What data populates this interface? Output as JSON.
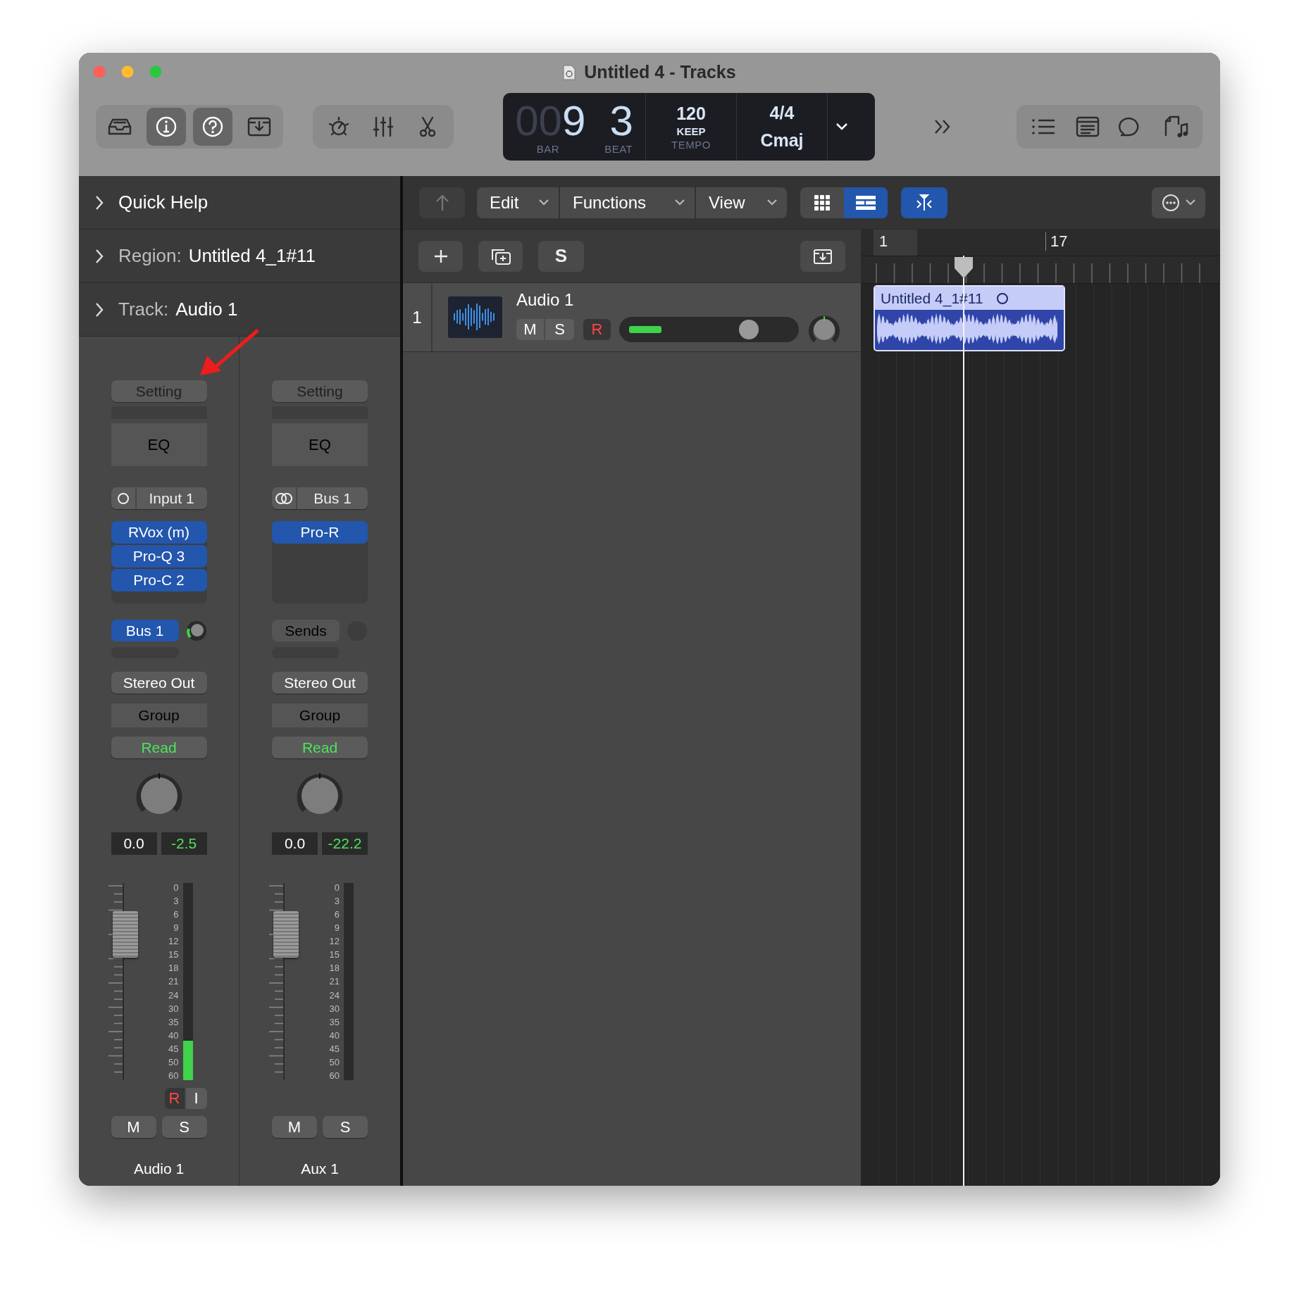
{
  "window": {
    "title": "Untitled 4 - Tracks"
  },
  "toolbar": {
    "left": [
      {
        "kind": "library",
        "selected": false
      },
      {
        "kind": "inspector",
        "selected": true
      },
      {
        "kind": "help",
        "selected": true
      },
      {
        "kind": "download",
        "selected": false
      }
    ],
    "middle": [
      {
        "kind": "gauge"
      },
      {
        "kind": "mixer"
      },
      {
        "kind": "scissors"
      }
    ],
    "lcd": {
      "bar_leading": "00",
      "bar": "9",
      "bar_label": "BAR",
      "beat": "3",
      "beat_label": "BEAT",
      "tempo": "120",
      "tempo_mode": "KEEP",
      "tempo_label": "TEMPO",
      "signature": "4/4",
      "key": "Cmaj"
    },
    "right": [
      {
        "kind": "list"
      },
      {
        "kind": "editor"
      },
      {
        "kind": "loops"
      },
      {
        "kind": "browser"
      }
    ]
  },
  "inspector": {
    "sections": [
      {
        "label": "Quick Help"
      },
      {
        "label": "Region:",
        "value": "Untitled 4_1#11"
      },
      {
        "label": "Track:",
        "value": "Audio 1"
      }
    ],
    "strips": [
      {
        "setting": "Setting",
        "eq": "EQ",
        "input": {
          "kind": "mono",
          "label": "Input 1"
        },
        "plugins": [
          "RVox (m)",
          "Pro-Q 3",
          "Pro-C 2"
        ],
        "send": {
          "kind": "bus",
          "label": "Bus 1"
        },
        "output": "Stereo Out",
        "group": "Group",
        "automation": "Read",
        "volume": "0.0",
        "peak": "-2.5",
        "fader": {
          "level": 0.74
        },
        "meter": {
          "level": 0.2
        },
        "scale": [
          "0",
          "3",
          "6",
          "9",
          "12",
          "15",
          "18",
          "21",
          "24",
          "30",
          "35",
          "40",
          "45",
          "50",
          "60"
        ],
        "record": "R",
        "monitor": "I",
        "mute": "M",
        "solo": "S",
        "name": "Audio 1"
      },
      {
        "setting": "Setting",
        "eq": "EQ",
        "input": {
          "kind": "stereo",
          "label": "Bus 1"
        },
        "plugins": [
          "Pro-R"
        ],
        "send": {
          "kind": "empty",
          "label": "Sends"
        },
        "output": "Stereo Out",
        "group": "Group",
        "automation": "Read",
        "volume": "0.0",
        "peak": "-22.2",
        "fader": {
          "level": 0.74
        },
        "meter": {
          "level": 0
        },
        "scale": [
          "0",
          "3",
          "6",
          "9",
          "12",
          "15",
          "18",
          "21",
          "24",
          "30",
          "35",
          "40",
          "45",
          "50",
          "60"
        ],
        "mute": "M",
        "solo": "S",
        "name": "Aux 1"
      }
    ]
  },
  "tracks_toolbar": {
    "menus": [
      {
        "label": "Edit"
      },
      {
        "label": "Functions"
      },
      {
        "label": "View"
      }
    ],
    "views": [
      {
        "kind": "grid",
        "selected": false
      },
      {
        "kind": "list",
        "selected": true
      }
    ],
    "catch": {
      "selected": true
    }
  },
  "track_header": {
    "buttons": [
      {
        "kind": "add"
      },
      {
        "kind": "duplicate"
      },
      {
        "kind": "solo",
        "label": "S"
      }
    ]
  },
  "tracks": [
    {
      "number": "1",
      "name": "Audio 1",
      "mute": "M",
      "solo": "S",
      "record": "R",
      "selected": true,
      "volume": {
        "level": 0.72
      },
      "meter": {
        "level": 0.2
      }
    }
  ],
  "ruler": {
    "markers": [
      {
        "label": "1"
      },
      {
        "label": "17"
      }
    ]
  },
  "regions": [
    {
      "name": "Untitled 4_1#11"
    }
  ]
}
